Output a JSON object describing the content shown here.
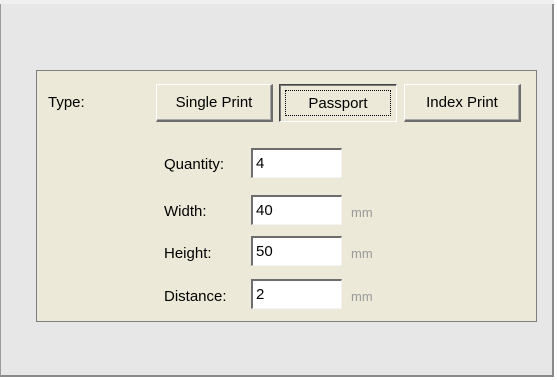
{
  "type_section": {
    "label": "Type:",
    "buttons": [
      {
        "label": "Single Print"
      },
      {
        "label": "Passport",
        "pressed": true
      },
      {
        "label": "Index Print"
      }
    ]
  },
  "fields": {
    "quantity": {
      "label": "Quantity:",
      "value": "4"
    },
    "width": {
      "label": "Width:",
      "value": "40",
      "unit": "mm"
    },
    "height": {
      "label": "Height:",
      "value": "50",
      "unit": "mm"
    },
    "distance": {
      "label": "Distance:",
      "value": "2",
      "unit": "mm"
    }
  },
  "colors": {
    "panel_background": "#ece9d8",
    "outer_background": "#e7e7e7",
    "unit_text": "#9a9a9a"
  }
}
